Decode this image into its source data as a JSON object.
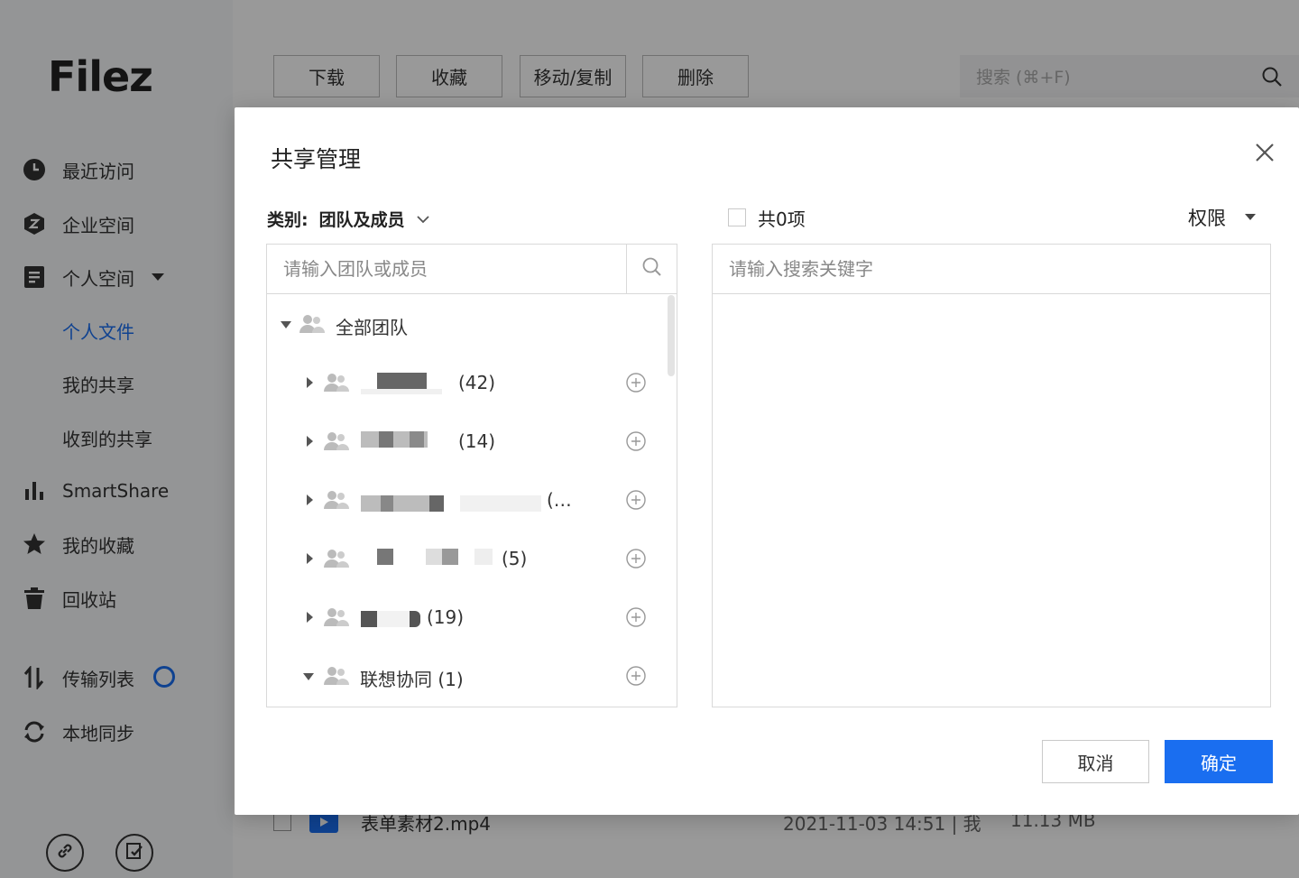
{
  "app": {
    "logo": "Filez"
  },
  "sidebar": {
    "items": [
      {
        "label": "最近访问"
      },
      {
        "label": "企业空间"
      },
      {
        "label": "个人空间"
      },
      {
        "label": "个人文件"
      },
      {
        "label": "我的共享"
      },
      {
        "label": "收到的共享"
      },
      {
        "label": "SmartShare"
      },
      {
        "label": "我的收藏"
      },
      {
        "label": "回收站"
      },
      {
        "label": "传输列表"
      },
      {
        "label": "本地同步"
      }
    ]
  },
  "toolbar": {
    "download": "下载",
    "favorite": "收藏",
    "move_copy": "移动/复制",
    "delete": "删除",
    "search_placeholder": "搜索  (⌘+F)"
  },
  "file_row": {
    "name": "表单素材2.mp4",
    "modified": "2021-11-03 14:51 | 我",
    "size": "11.13 MB"
  },
  "modal": {
    "title": "共享管理",
    "category_label": "类别:",
    "category_value": "团队及成员",
    "left_search_placeholder": "请输入团队或成员",
    "tree": {
      "root": "全部团队",
      "groups": [
        {
          "count": "(42)"
        },
        {
          "count": "(14)"
        },
        {
          "count": "(…"
        },
        {
          "count": "(5)"
        },
        {
          "count": "(19)"
        },
        {
          "count": "联想协同 (1)"
        }
      ]
    },
    "right_count": "共0项",
    "permission_label": "权限",
    "right_search_placeholder": "请输入搜索关键字",
    "cancel": "取消",
    "ok": "确定"
  },
  "colors": {
    "accent": "#1a6ef0",
    "overlay": "rgba(0,0,0,0.4)"
  }
}
